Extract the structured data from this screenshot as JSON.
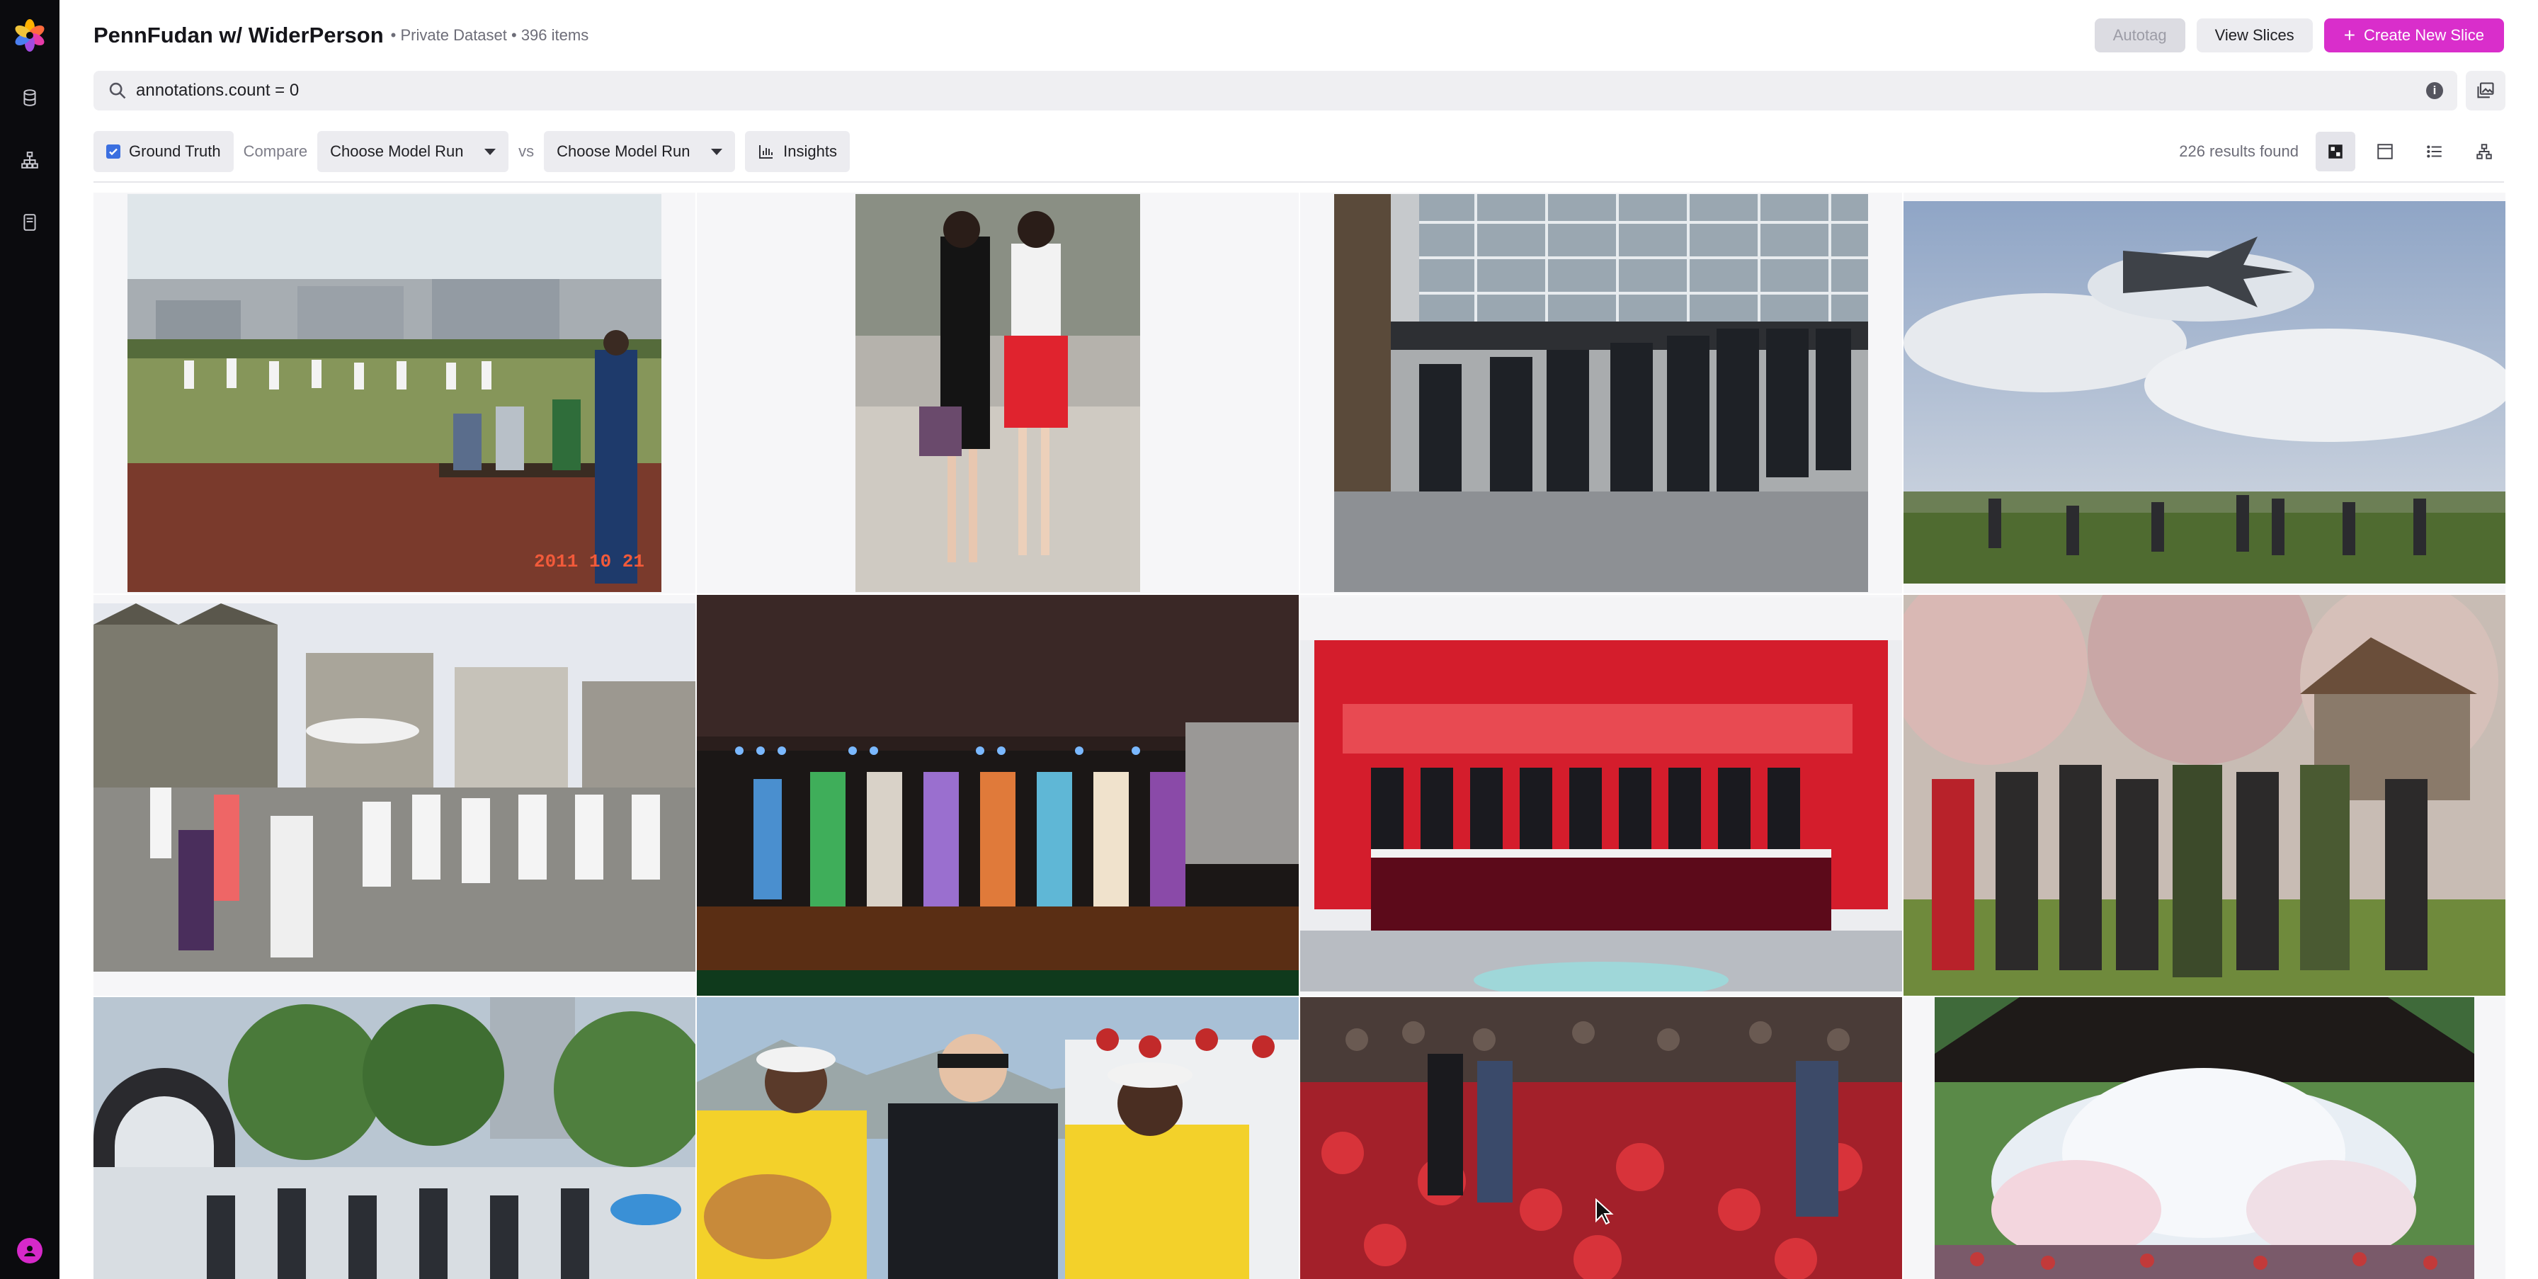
{
  "app": {
    "brand_color": "#d92ecb",
    "rail_icons": [
      "flower-logo-icon",
      "database-icon",
      "hierarchy-icon",
      "document-icon"
    ],
    "avatar_icon": "user-avatar-icon"
  },
  "header": {
    "title": "PennFudan w/ WiderPerson",
    "meta": "• Private Dataset • 396 items",
    "autotag_label": "Autotag",
    "view_slices_label": "View Slices",
    "create_slice_label": "Create New Slice",
    "create_slice_plus": "+"
  },
  "search": {
    "query": "annotations.count = 0",
    "info_glyph": "i"
  },
  "filters": {
    "ground_truth_label": "Ground Truth",
    "ground_truth_checked": true,
    "compare_label": "Compare",
    "model_run_a": "Choose Model Run",
    "vs_label": "vs",
    "model_run_b": "Choose Model Run",
    "insights_label": "Insights",
    "results_text": "226 results found"
  },
  "grid": {
    "photo_stamp": "2011 10 21",
    "items": [
      {
        "scene": "soccer field with players and spectators on a bench"
      },
      {
        "scene": "two women walking on a city street"
      },
      {
        "scene": "crowd queuing outside a glass building"
      },
      {
        "scene": "fighter jet over people watching in a field"
      },
      {
        "scene": "elderly group doing tai chi in a town square"
      },
      {
        "scene": "dancers performing on a lit stage"
      },
      {
        "scene": "signing ceremony in front of a red banner"
      },
      {
        "scene": "photographers with cameras under cherry trees"
      },
      {
        "scene": "crowd in a park near a tunnel"
      },
      {
        "scene": "musicians with a guitar on a boat"
      },
      {
        "scene": "people walking through red flower beds at night"
      },
      {
        "scene": "water fountain splashing at a festival"
      }
    ]
  }
}
